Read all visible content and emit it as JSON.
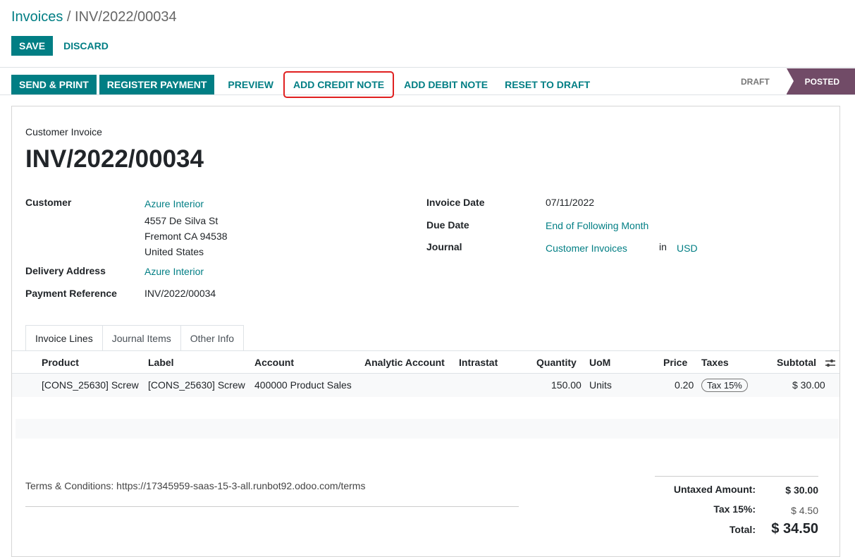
{
  "breadcrumb": {
    "parent": "Invoices",
    "separator": " / ",
    "current": "INV/2022/00034"
  },
  "form_buttons": {
    "save": "SAVE",
    "discard": "DISCARD"
  },
  "actions": {
    "send_print": "SEND & PRINT",
    "register_payment": "REGISTER PAYMENT",
    "preview": "PREVIEW",
    "add_credit_note": "ADD CREDIT NOTE",
    "add_debit_note": "ADD DEBIT NOTE",
    "reset_to_draft": "RESET TO DRAFT"
  },
  "stages": {
    "draft": "DRAFT",
    "posted": "POSTED",
    "current": "POSTED"
  },
  "document": {
    "type": "Customer Invoice",
    "name": "INV/2022/00034"
  },
  "fields": {
    "customer_label": "Customer",
    "customer_name": "Azure Interior",
    "address_line1": "4557 De Silva St",
    "address_line2": "Fremont CA 94538",
    "address_line3": "United States",
    "delivery_label": "Delivery Address",
    "delivery_value": "Azure Interior",
    "payment_ref_label": "Payment Reference",
    "payment_ref_value": "INV/2022/00034",
    "invoice_date_label": "Invoice Date",
    "invoice_date_value": "07/11/2022",
    "due_date_label": "Due Date",
    "due_date_value": "End of Following Month",
    "journal_label": "Journal",
    "journal_value": "Customer Invoices",
    "journal_in": "in",
    "currency": "USD"
  },
  "tabs": [
    {
      "label": "Invoice Lines",
      "active": true
    },
    {
      "label": "Journal Items",
      "active": false
    },
    {
      "label": "Other Info",
      "active": false
    }
  ],
  "table": {
    "columns": [
      "Product",
      "Label",
      "Account",
      "Analytic Account",
      "Intrastat",
      "Quantity",
      "UoM",
      "Price",
      "Taxes",
      "Subtotal"
    ],
    "rows": [
      {
        "product": "[CONS_25630] Screw",
        "label": "[CONS_25630] Screw",
        "account": "400000 Product Sales",
        "analytic": "",
        "intrastat": "",
        "quantity": "150.00",
        "uom": "Units",
        "price": "0.20",
        "taxes": "Tax 15%",
        "subtotal": "$ 30.00"
      }
    ]
  },
  "terms": "Terms & Conditions: https://17345959-saas-15-3-all.runbot92.odoo.com/terms",
  "totals": {
    "untaxed_label": "Untaxed Amount:",
    "untaxed_value": "$ 30.00",
    "tax_label": "Tax 15%:",
    "tax_value": "$ 4.50",
    "total_label": "Total:",
    "total_value": "$ 34.50"
  },
  "colors": {
    "primary": "#017e84",
    "stage_active": "#714b67",
    "highlight": "#e02020"
  }
}
